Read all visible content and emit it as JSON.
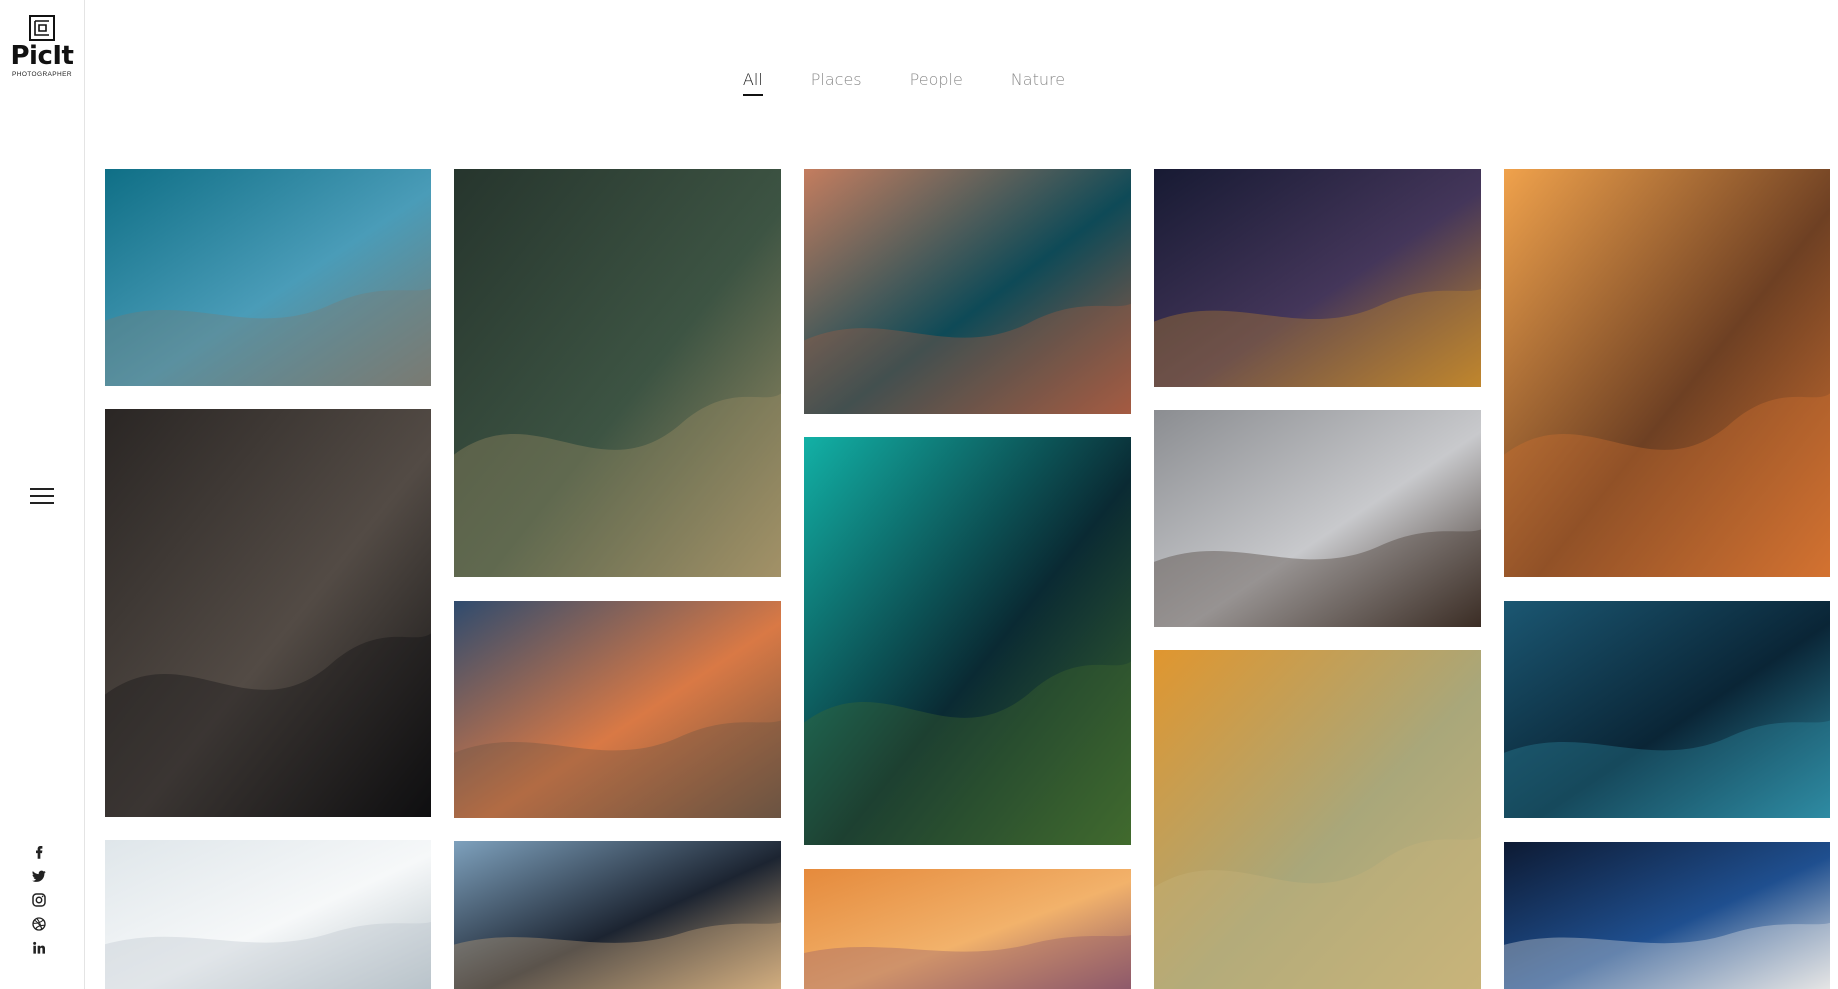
{
  "brand": {
    "name": "PicIt",
    "subtitle": "PHOTOGRAPHER"
  },
  "filters": [
    {
      "label": "All",
      "active": true
    },
    {
      "label": "Places",
      "active": false
    },
    {
      "label": "People",
      "active": false
    },
    {
      "label": "Nature",
      "active": false
    }
  ],
  "social": [
    "facebook-icon",
    "twitter-icon",
    "instagram-icon",
    "dribbble-icon",
    "linkedin-icon"
  ],
  "photos": [
    {
      "name": "photo-seaside-castle",
      "palette": [
        "#0f6f86",
        "#4a9cb8",
        "#7a7a72"
      ]
    },
    {
      "name": "photo-woman-black-jacket",
      "palette": [
        "#2a2624",
        "#534b45",
        "#0f0f10"
      ]
    },
    {
      "name": "photo-white-architecture",
      "palette": [
        "#dfe6ea",
        "#f6f8f9",
        "#b9c4ca"
      ]
    },
    {
      "name": "photo-forest-suspension-bridge",
      "palette": [
        "#26352d",
        "#3d5443",
        "#a39268"
      ]
    },
    {
      "name": "photo-beach-sunset-umbrellas",
      "palette": [
        "#2f4b6e",
        "#d97945",
        "#6b5442"
      ]
    },
    {
      "name": "photo-man-skyline",
      "palette": [
        "#7ea1bd",
        "#1c2431",
        "#d1ad7f"
      ]
    },
    {
      "name": "photo-aerial-red-rocks-tents",
      "palette": [
        "#c47d5f",
        "#0e4a57",
        "#a55b42"
      ]
    },
    {
      "name": "photo-aerial-turquoise-coast",
      "palette": [
        "#12b1a6",
        "#0a2a33",
        "#416b2d"
      ]
    },
    {
      "name": "photo-orange-sky-clouds",
      "palette": [
        "#e58a3c",
        "#f2b26b",
        "#8e5a6a"
      ]
    },
    {
      "name": "photo-night-city-view",
      "palette": [
        "#171a33",
        "#44365a",
        "#c0862d"
      ]
    },
    {
      "name": "photo-city-waterfront-buildings",
      "palette": [
        "#8b8d91",
        "#c8c9cc",
        "#3b2d25"
      ]
    },
    {
      "name": "photo-woman-sitting-court",
      "palette": [
        "#e0962f",
        "#a9a77a",
        "#c9b47a"
      ]
    },
    {
      "name": "photo-cliff-sunrise",
      "palette": [
        "#f0a24c",
        "#6e4023",
        "#d37231"
      ]
    },
    {
      "name": "photo-aquarium-woman",
      "palette": [
        "#1b5772",
        "#0a2536",
        "#2f8ba3"
      ]
    },
    {
      "name": "photo-blue-car-detail",
      "palette": [
        "#0d1a33",
        "#1f4f8f",
        "#e5e5e5"
      ]
    }
  ]
}
